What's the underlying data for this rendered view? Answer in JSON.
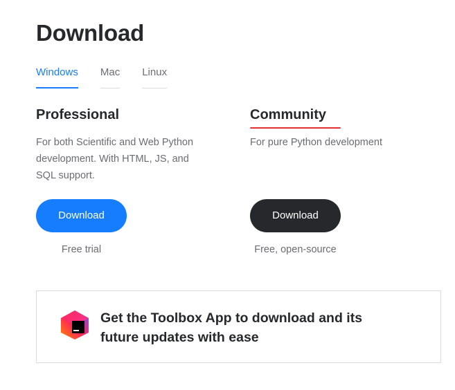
{
  "page": {
    "title": "Download"
  },
  "os_tabs": [
    {
      "label": "Windows",
      "active": true
    },
    {
      "label": "Mac",
      "active": false
    },
    {
      "label": "Linux",
      "active": false
    }
  ],
  "editions": {
    "professional": {
      "name": "Professional",
      "description": "For both Scientific and Web Python development. With HTML, JS, and SQL support.",
      "button_label": "Download",
      "note": "Free trial"
    },
    "community": {
      "name": "Community",
      "description": "For pure Python development",
      "button_label": "Download",
      "note": "Free, open-source"
    }
  },
  "toolbox": {
    "text": "Get the Toolbox App to download and its future updates with ease",
    "icon": "toolbox-app-logo"
  },
  "colors": {
    "accent_blue": "#167dff",
    "dark_button": "#27282c",
    "highlight_underline": "#e22e2e"
  }
}
